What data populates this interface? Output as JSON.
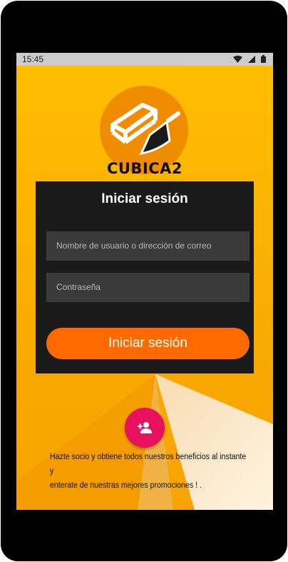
{
  "status_bar": {
    "time": "15:45",
    "icons": [
      "wifi-icon",
      "signal-icon",
      "battery-icon"
    ]
  },
  "brand": {
    "name": "CUBICA2",
    "logo_icon": "brick-and-trowel-icon"
  },
  "login_panel": {
    "title": "Iniciar sesión",
    "username_placeholder": "Nombre de usuario o dirección de correo",
    "password_placeholder": "Contraseña",
    "submit_label": "Iniciar sesión"
  },
  "signup": {
    "fab_icon": "add-person-icon",
    "promo_line1": "Hazte socio y obtiene todos nuestros beneficios al instante y",
    "promo_line2": "enterate de nuestras mejores promociones ! ."
  },
  "colors": {
    "background": "#f7b000",
    "panel": "#1a1a1a",
    "field": "#3a3a3a",
    "button": "#ff6a00",
    "fab": "#ea1060",
    "logo_circle": "#f08c00"
  }
}
